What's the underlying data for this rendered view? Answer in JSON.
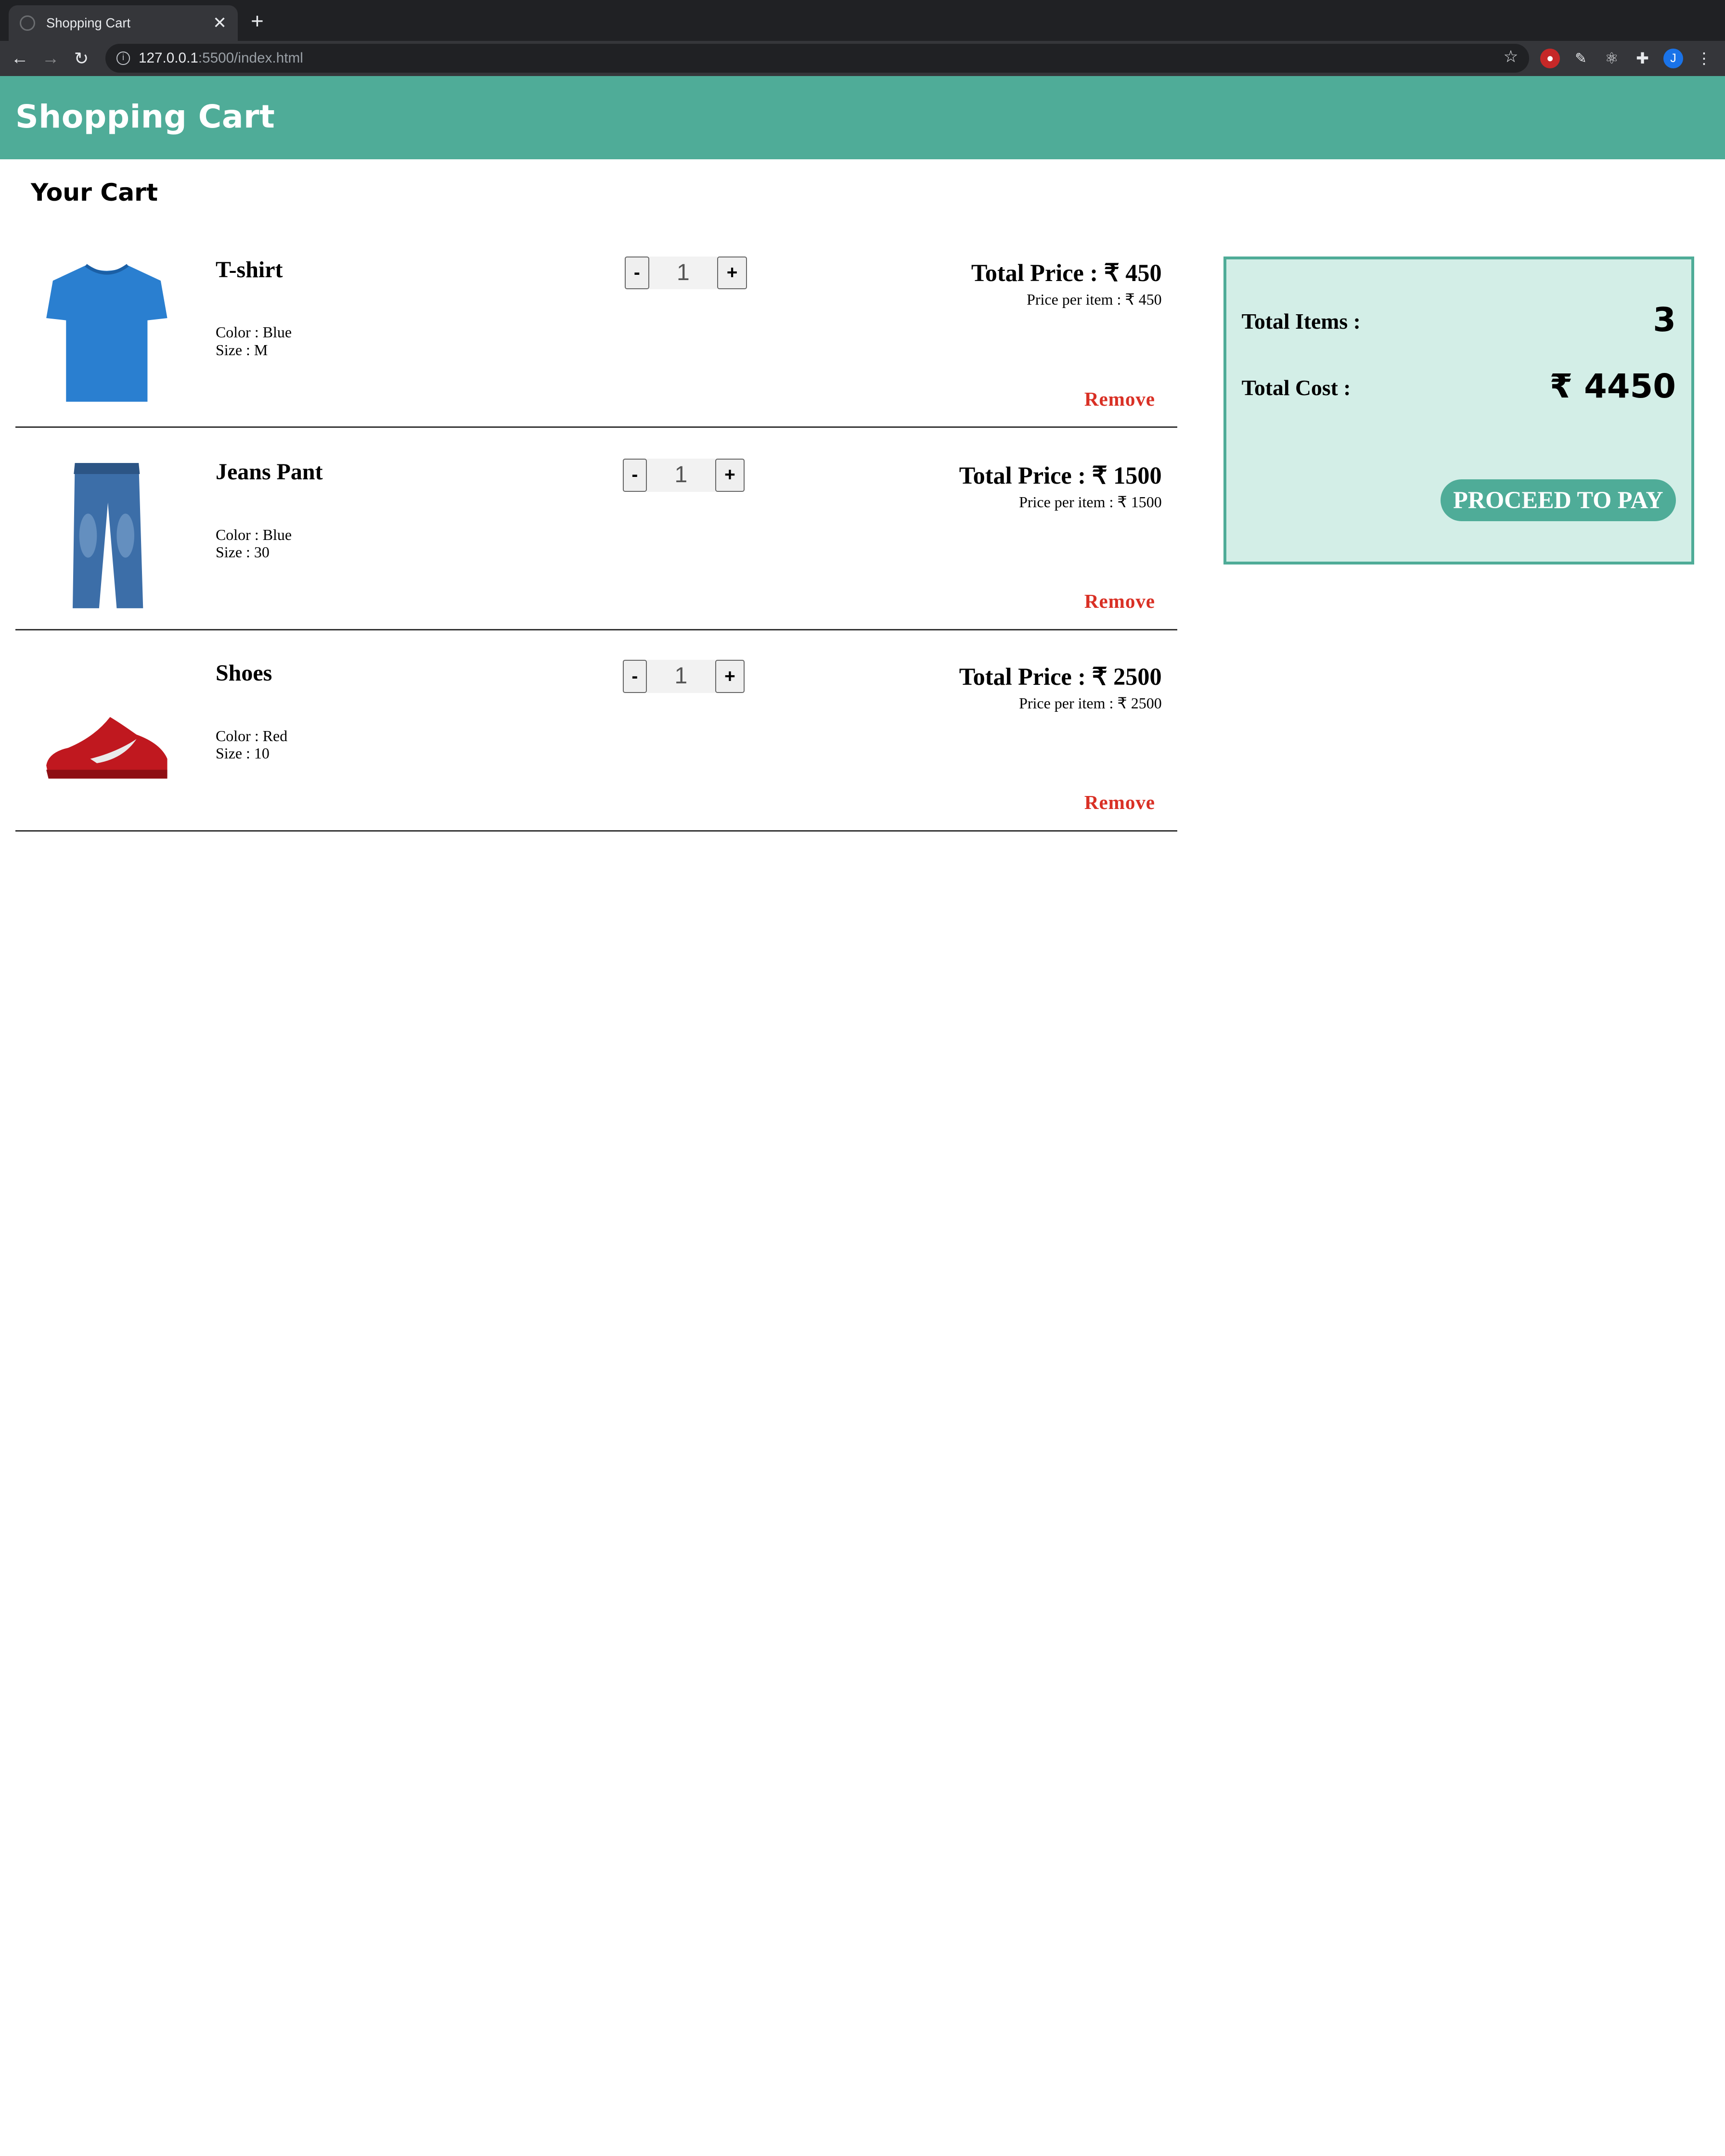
{
  "browser": {
    "tab_title": "Shopping Cart",
    "close": "✕",
    "new_tab": "+",
    "url_host": "127.0.0.1",
    "url_path": ":5500/index.html",
    "avatar_initial": "J"
  },
  "header": {
    "title": "Shopping Cart"
  },
  "cart": {
    "heading": "Your Cart"
  },
  "items": [
    {
      "name": "T-shirt",
      "color": "Color : Blue",
      "size": "Size : M",
      "qty": "1",
      "total": "Total Price : ₹ 450",
      "per_item": "Price per item : ₹ 450",
      "remove": "Remove"
    },
    {
      "name": "Jeans Pant",
      "color": "Color : Blue",
      "size": "Size : 30",
      "qty": "1",
      "total": "Total Price : ₹ 1500",
      "per_item": "Price per item : ₹ 1500",
      "remove": "Remove"
    },
    {
      "name": "Shoes",
      "color": "Color : Red",
      "size": "Size : 10",
      "qty": "1",
      "total": "Total Price : ₹ 2500",
      "per_item": "Price per item : ₹ 2500",
      "remove": "Remove"
    }
  ],
  "qty_controls": {
    "minus": "-",
    "plus": "+"
  },
  "summary": {
    "items_label": "Total Items :",
    "items_value": "3",
    "cost_label": "Total Cost :",
    "cost_value": "₹ 4450",
    "pay_button": "PROCEED TO PAY"
  },
  "colors": {
    "accent": "#4fac98",
    "summary_bg": "#d3eee7",
    "remove": "#d93025"
  }
}
